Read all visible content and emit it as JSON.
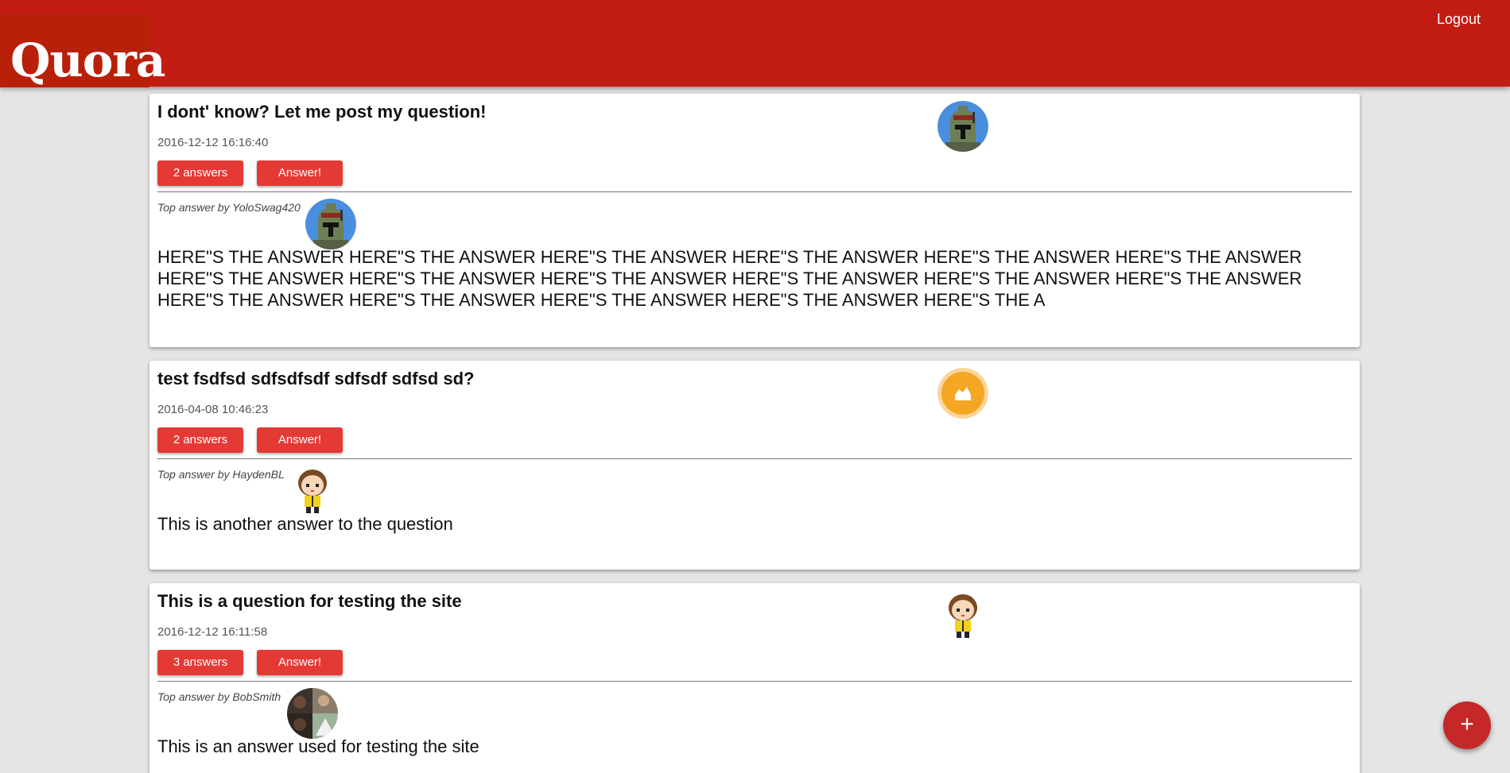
{
  "header": {
    "logo_text": "Quora",
    "logout_label": "Logout",
    "bar_color": "#c21c13"
  },
  "questions": [
    {
      "title": "I dont' know? Let me post my question!",
      "date": "2016-12-12 16:16:40",
      "answers_label": "2 answers",
      "answer_button": "Answer!",
      "asker_avatar": "helmet-avatar",
      "top_answer_label": "Top answer by YoloSwag420",
      "top_answer_avatar": "helmet-avatar",
      "top_answer_text": "HERE\"S THE ANSWER HERE\"S THE ANSWER HERE\"S THE ANSWER HERE\"S THE ANSWER HERE\"S THE ANSWER HERE\"S THE ANSWER HERE\"S THE ANSWER HERE\"S THE ANSWER HERE\"S THE ANSWER HERE\"S THE ANSWER HERE\"S THE ANSWER HERE\"S THE ANSWER HERE\"S THE ANSWER HERE\"S THE ANSWER HERE\"S THE ANSWER HERE\"S THE ANSWER HERE\"S THE A"
    },
    {
      "title": "test fsdfsd sdfsdfsdf sdfsdf sdfsd sd?",
      "date": "2016-04-08 10:46:23",
      "answers_label": "2 answers",
      "answer_button": "Answer!",
      "asker_avatar": "orange-badge-avatar",
      "top_answer_label": "Top answer by HaydenBL",
      "top_answer_avatar": "cartoon-boy-avatar",
      "top_answer_text": "This is another answer to the question"
    },
    {
      "title": "This is a question for testing the site",
      "date": "2016-12-12 16:11:58",
      "answers_label": "3 answers",
      "answer_button": "Answer!",
      "asker_avatar": "cartoon-boy-avatar",
      "top_answer_label": "Top answer by BobSmith",
      "top_answer_avatar": "photo-collage-avatar",
      "top_answer_text": "This is an answer used for testing the site"
    }
  ],
  "fab": {
    "icon": "plus-icon",
    "label": "+"
  },
  "colors": {
    "button": "#e53935",
    "fab": "#c62828",
    "background": "#e5e5e5"
  }
}
